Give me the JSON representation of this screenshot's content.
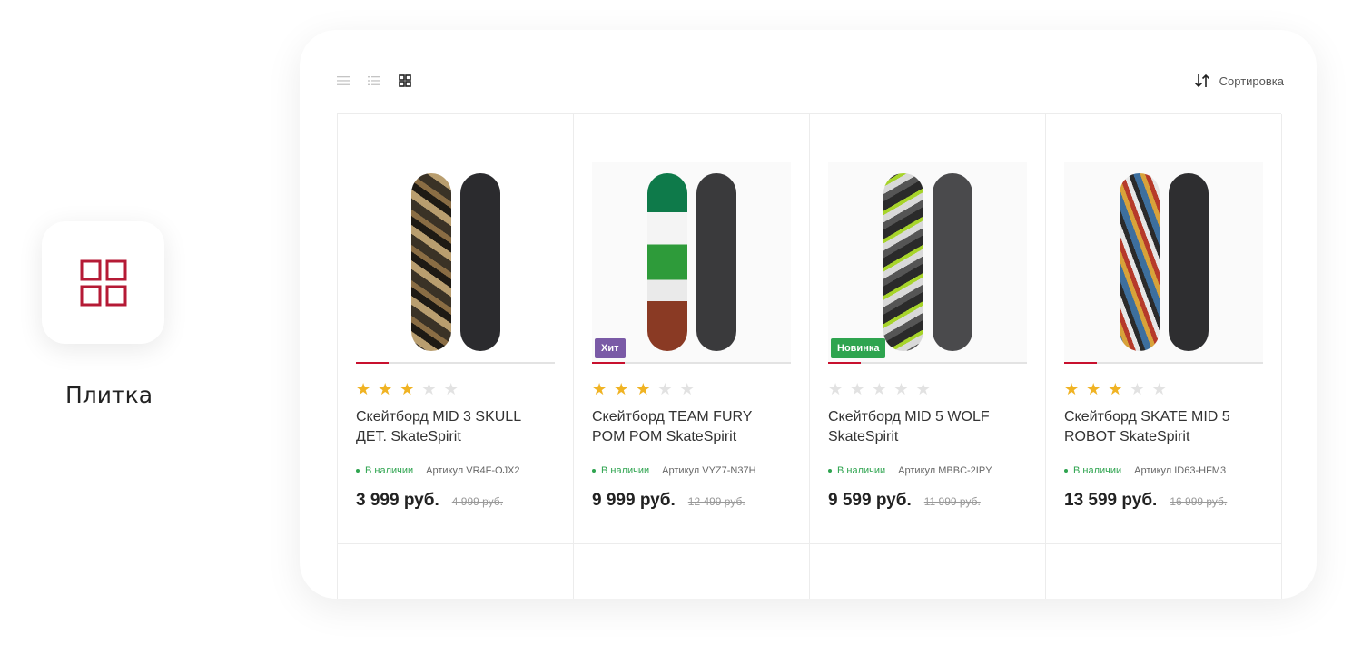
{
  "feature": {
    "icon": "grid-tile-icon",
    "label": "Плитка",
    "accent_color": "#b51a35"
  },
  "toolbar": {
    "views": [
      {
        "icon": "list-view-icon",
        "active": false
      },
      {
        "icon": "compact-list-view-icon",
        "active": false
      },
      {
        "icon": "tile-view-icon",
        "active": true
      }
    ],
    "sort_icon": "sort-arrows-icon",
    "sort_label": "Сортировка"
  },
  "colors": {
    "star_filled": "#f0b323",
    "star_empty": "#e2e2e2",
    "stock": "#2ea44f",
    "badge_hit": "#7a5aa6",
    "badge_new": "#2ea44f"
  },
  "products": [
    {
      "badge": "",
      "badge_type": "",
      "rating": 3,
      "title": "Скейтборд MID 3 SKULL ДЕТ. SkateSpirit",
      "stock": "В наличии",
      "sku": "Артикул VR4F-OJX2",
      "price": "3 999 руб.",
      "old_price": "4 999 руб."
    },
    {
      "badge": "Хит",
      "badge_type": "hit",
      "rating": 3,
      "title": "Скейтборд TEAM FURY POM POM SkateSpirit",
      "stock": "В наличии",
      "sku": "Артикул VYZ7-N37H",
      "price": "9 999 руб.",
      "old_price": "12 499 руб."
    },
    {
      "badge": "Новинка",
      "badge_type": "new",
      "rating": 0,
      "title": "Скейтборд MID 5 WOLF SkateSpirit",
      "stock": "В наличии",
      "sku": "Артикул MBBC-2IPY",
      "price": "9 599 руб.",
      "old_price": "11 999 руб."
    },
    {
      "badge": "",
      "badge_type": "",
      "rating": 3,
      "title": "Скейтборд SKATE MID 5 ROBOT SkateSpirit",
      "stock": "В наличии",
      "sku": "Артикул ID63-HFM3",
      "price": "13 599 руб.",
      "old_price": "16 999 руб."
    }
  ]
}
